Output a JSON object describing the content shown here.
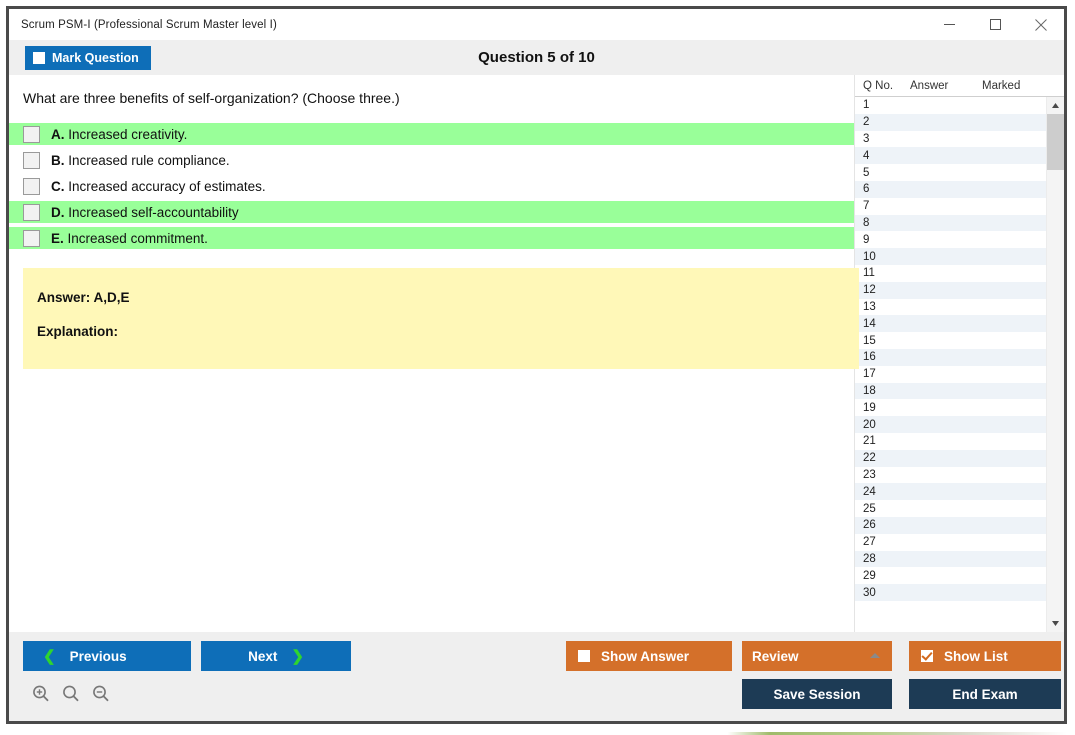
{
  "window": {
    "title": "Scrum PSM-I (Professional Scrum Master level I)",
    "controls": {
      "minimize": "minimize-icon",
      "maximize": "maximize-icon",
      "close": "close-icon"
    }
  },
  "header": {
    "mark_question_label": "Mark Question",
    "mark_question_checked": false,
    "question_counter": "Question 5 of 10",
    "accent_blue": "#0e6eb8"
  },
  "question": {
    "text": "What are three benefits of self-organization? (Choose three.)",
    "options": [
      {
        "letter": "A.",
        "text": "Increased creativity.",
        "correct": true,
        "checked": false
      },
      {
        "letter": "B.",
        "text": "Increased rule compliance.",
        "correct": false,
        "checked": false
      },
      {
        "letter": "C.",
        "text": "Increased accuracy of estimates.",
        "correct": false,
        "checked": false
      },
      {
        "letter": "D.",
        "text": "Increased self-accountability",
        "correct": true,
        "checked": false
      },
      {
        "letter": "E.",
        "text": "Increased commitment.",
        "correct": true,
        "checked": false
      }
    ],
    "highlight_color": "#99ff99"
  },
  "answer_panel": {
    "answer_line": "Answer: A,D,E",
    "explanation_line": "Explanation:",
    "background_color": "#fff8b8"
  },
  "question_list": {
    "columns": [
      "Q No.",
      "Answer",
      "Marked"
    ],
    "rows": [
      {
        "no": "1",
        "answer": "",
        "marked": ""
      },
      {
        "no": "2",
        "answer": "",
        "marked": ""
      },
      {
        "no": "3",
        "answer": "",
        "marked": ""
      },
      {
        "no": "4",
        "answer": "",
        "marked": ""
      },
      {
        "no": "5",
        "answer": "",
        "marked": ""
      },
      {
        "no": "6",
        "answer": "",
        "marked": ""
      },
      {
        "no": "7",
        "answer": "",
        "marked": ""
      },
      {
        "no": "8",
        "answer": "",
        "marked": ""
      },
      {
        "no": "9",
        "answer": "",
        "marked": ""
      },
      {
        "no": "10",
        "answer": "",
        "marked": ""
      },
      {
        "no": "11",
        "answer": "",
        "marked": ""
      },
      {
        "no": "12",
        "answer": "",
        "marked": ""
      },
      {
        "no": "13",
        "answer": "",
        "marked": ""
      },
      {
        "no": "14",
        "answer": "",
        "marked": ""
      },
      {
        "no": "15",
        "answer": "",
        "marked": ""
      },
      {
        "no": "16",
        "answer": "",
        "marked": ""
      },
      {
        "no": "17",
        "answer": "",
        "marked": ""
      },
      {
        "no": "18",
        "answer": "",
        "marked": ""
      },
      {
        "no": "19",
        "answer": "",
        "marked": ""
      },
      {
        "no": "20",
        "answer": "",
        "marked": ""
      },
      {
        "no": "21",
        "answer": "",
        "marked": ""
      },
      {
        "no": "22",
        "answer": "",
        "marked": ""
      },
      {
        "no": "23",
        "answer": "",
        "marked": ""
      },
      {
        "no": "24",
        "answer": "",
        "marked": ""
      },
      {
        "no": "25",
        "answer": "",
        "marked": ""
      },
      {
        "no": "26",
        "answer": "",
        "marked": ""
      },
      {
        "no": "27",
        "answer": "",
        "marked": ""
      },
      {
        "no": "28",
        "answer": "",
        "marked": ""
      },
      {
        "no": "29",
        "answer": "",
        "marked": ""
      },
      {
        "no": "30",
        "answer": "",
        "marked": ""
      }
    ]
  },
  "footer": {
    "previous_label": "Previous",
    "next_label": "Next",
    "show_answer_label": "Show Answer",
    "show_answer_checked": false,
    "review_label": "Review",
    "show_list_label": "Show List",
    "show_list_checked": true,
    "save_session_label": "Save Session",
    "end_exam_label": "End Exam",
    "orange": "#d4702a",
    "navy": "#1d3b55",
    "chevron_green": "#2fd42f",
    "zoom_icons": [
      "zoom-in-icon",
      "zoom-reset-icon",
      "zoom-out-icon"
    ]
  }
}
